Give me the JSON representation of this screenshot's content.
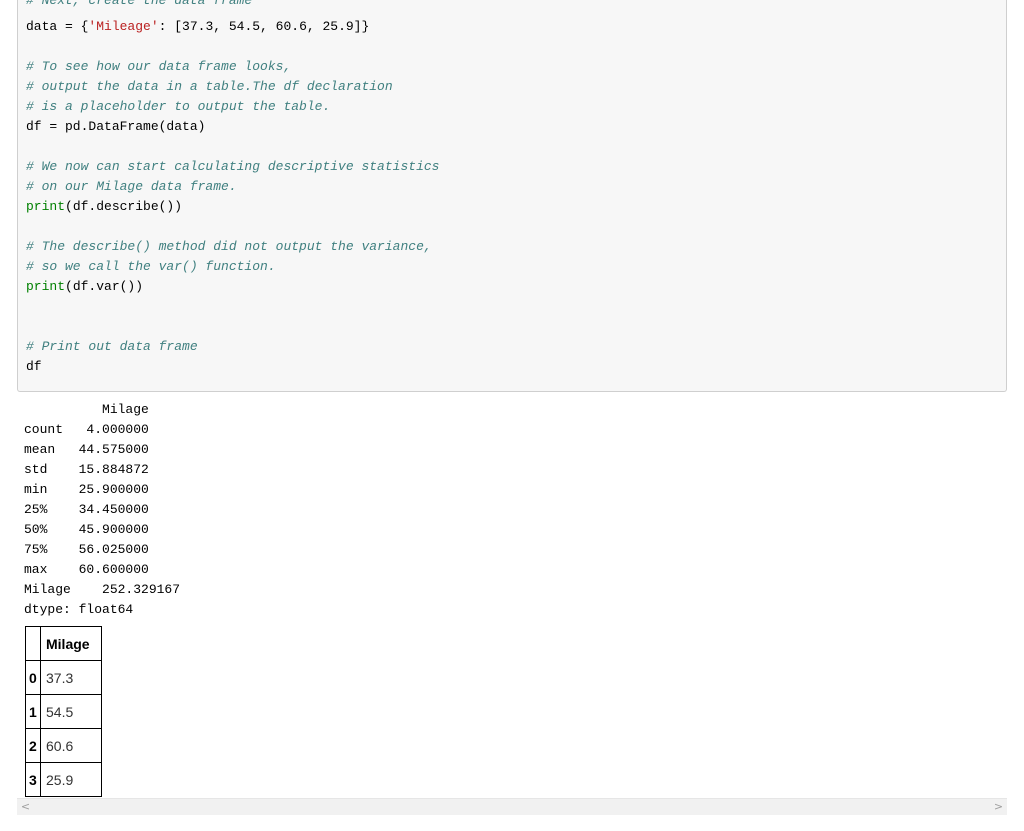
{
  "code_cell": {
    "partial_top_line": "# Next, create the data frame",
    "lines": [
      {
        "parts": [
          {
            "t": "data = {",
            "c": ""
          },
          {
            "t": "'Mileage'",
            "c": "string"
          },
          {
            "t": ": [37.3, 54.5, 60.6, 25.9]}",
            "c": ""
          }
        ]
      },
      {
        "parts": []
      },
      {
        "parts": [
          {
            "t": "# To see how our data frame looks,",
            "c": "comment"
          }
        ]
      },
      {
        "parts": [
          {
            "t": "# output the data in a table.The df declaration",
            "c": "comment"
          }
        ]
      },
      {
        "parts": [
          {
            "t": "# is a placeholder to output the table.",
            "c": "comment"
          }
        ]
      },
      {
        "parts": [
          {
            "t": "df = pd.DataFrame(data)",
            "c": ""
          }
        ]
      },
      {
        "parts": []
      },
      {
        "parts": [
          {
            "t": "# We now can start calculating descriptive statistics",
            "c": "comment"
          }
        ]
      },
      {
        "parts": [
          {
            "t": "# on our Milage data frame.",
            "c": "comment"
          }
        ]
      },
      {
        "parts": [
          {
            "t": "print",
            "c": "builtin"
          },
          {
            "t": "(df.describe())",
            "c": ""
          }
        ]
      },
      {
        "parts": []
      },
      {
        "parts": [
          {
            "t": "# The describe() method did not output the variance,",
            "c": "comment"
          }
        ]
      },
      {
        "parts": [
          {
            "t": "# so we call the var() function.",
            "c": "comment"
          }
        ]
      },
      {
        "parts": [
          {
            "t": "print",
            "c": "builtin"
          },
          {
            "t": "(df.var())",
            "c": ""
          }
        ]
      },
      {
        "parts": []
      },
      {
        "parts": []
      },
      {
        "parts": [
          {
            "t": "# Print out data frame",
            "c": "comment"
          }
        ]
      },
      {
        "parts": [
          {
            "t": "df",
            "c": ""
          }
        ]
      }
    ]
  },
  "output": {
    "text_lines": [
      "          Milage",
      "count   4.000000",
      "mean   44.575000",
      "std    15.884872",
      "min    25.900000",
      "25%    34.450000",
      "50%    45.900000",
      "75%    56.025000",
      "max    60.600000",
      "Milage    252.329167",
      "dtype: float64"
    ],
    "dataframe": {
      "column_header": "Milage",
      "rows": [
        {
          "index": "0",
          "value": "37.3"
        },
        {
          "index": "1",
          "value": "54.5"
        },
        {
          "index": "2",
          "value": "60.6"
        },
        {
          "index": "3",
          "value": "25.9"
        }
      ]
    }
  },
  "scrollbar": {
    "left_arrow": "<",
    "right_arrow": ">"
  }
}
